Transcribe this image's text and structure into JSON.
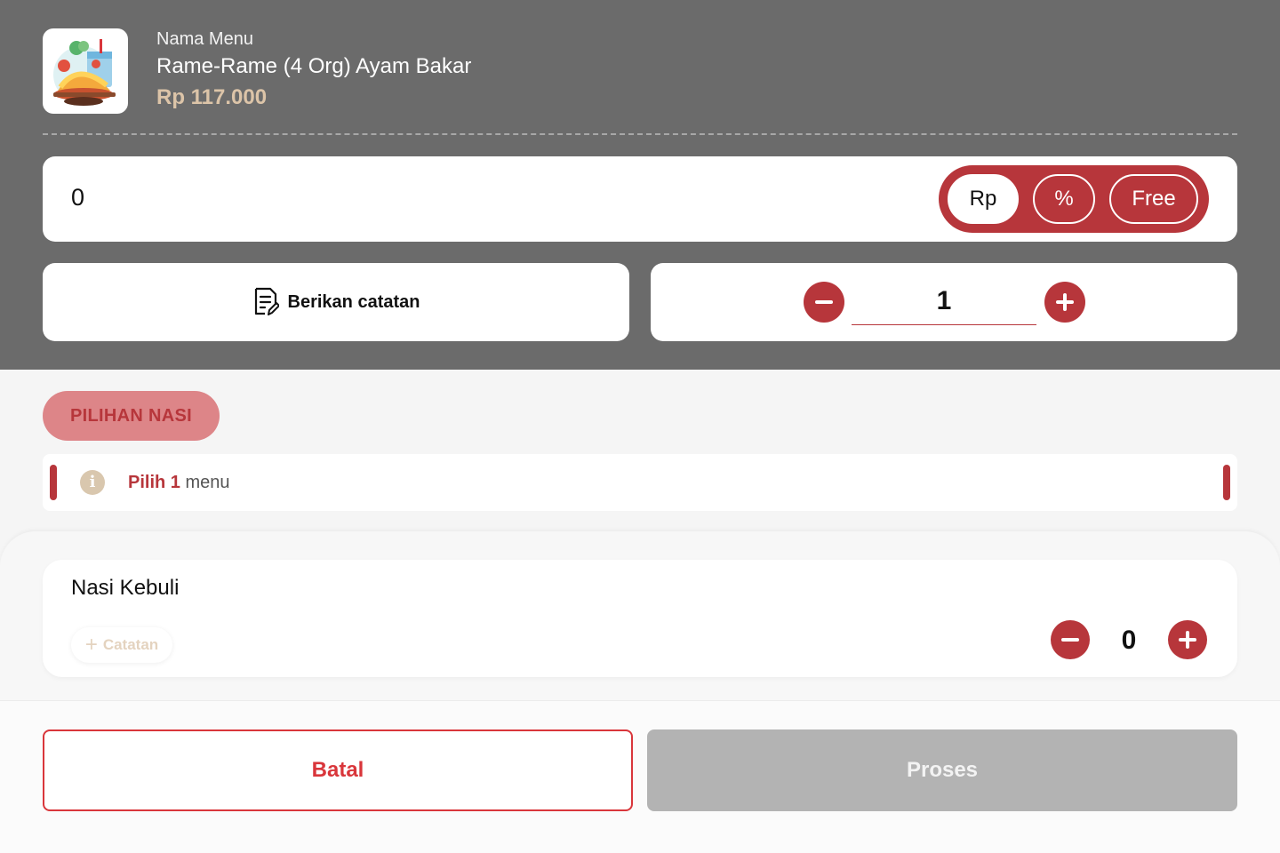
{
  "header": {
    "label": "Nama Menu",
    "name": "Rame-Rame (4 Org) Ayam Bakar",
    "price": "Rp 117.000",
    "image_icon": "food-plate-icon"
  },
  "discount": {
    "value": "0",
    "options": [
      "Rp",
      "%",
      "Free"
    ],
    "selected": "Rp"
  },
  "note": {
    "label": "Berikan catatan",
    "icon": "note-edit-icon"
  },
  "quantity": {
    "value": "1"
  },
  "section": {
    "title": "PILIHAN NASI",
    "info_prefix": "Pilih 1",
    "info_suffix": " menu",
    "info_icon": "info-icon"
  },
  "items": [
    {
      "name": "Nasi Kebuli",
      "note_label": "Catatan",
      "qty": "0"
    }
  ],
  "footer": {
    "cancel_label": "Batal",
    "process_label": "Proses"
  },
  "colors": {
    "accent": "#b7363b",
    "header_bg": "#6b6b6b",
    "price": "#dcc4a8",
    "disabled": "#b3b3b3"
  }
}
